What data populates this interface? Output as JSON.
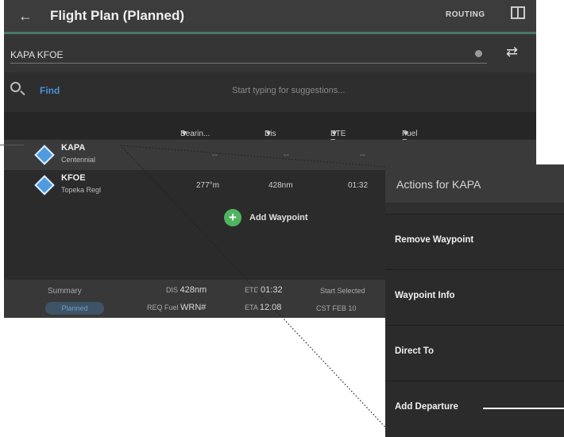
{
  "titlebar": {
    "back_icon": "←",
    "title": "Flight Plan (Planned)",
    "routing_label": "ROUTING"
  },
  "route": {
    "value": "KAPA KFOE"
  },
  "search": {
    "find_label": "Find",
    "placeholder": "Start typing for suggestions..."
  },
  "columns": [
    "Bearin...",
    "Dis",
    "ETE To",
    "Fuel Re..."
  ],
  "waypoints": [
    {
      "id": "KAPA",
      "name": "Centennial",
      "bearing": "--",
      "distance": "--",
      "ete": "--",
      "fuel": "--"
    },
    {
      "id": "KFOE",
      "name": "Topeka Regl",
      "bearing": "277°m",
      "distance": "428nm",
      "ete": "01:32",
      "fuel": ""
    }
  ],
  "add_waypoint": {
    "label": "Add Waypoint"
  },
  "summary": {
    "label": "Summary",
    "mode": "Planned",
    "dis_prefix": "DIS",
    "dis_value": "428nm",
    "fuel_prefix": "REQ Fuel",
    "fuel_value": "WRN#",
    "ete_prefix": "ETE",
    "ete_value": "01:32",
    "eta_prefix": "ETA",
    "eta_value": "12:08",
    "start_text": "Start Selected",
    "date_text": "CST FEB 10"
  },
  "actions_panel": {
    "title": "Actions for KAPA",
    "items": [
      "Remove Waypoint",
      "Waypoint Info",
      "Direct To",
      "Add Departure"
    ]
  }
}
